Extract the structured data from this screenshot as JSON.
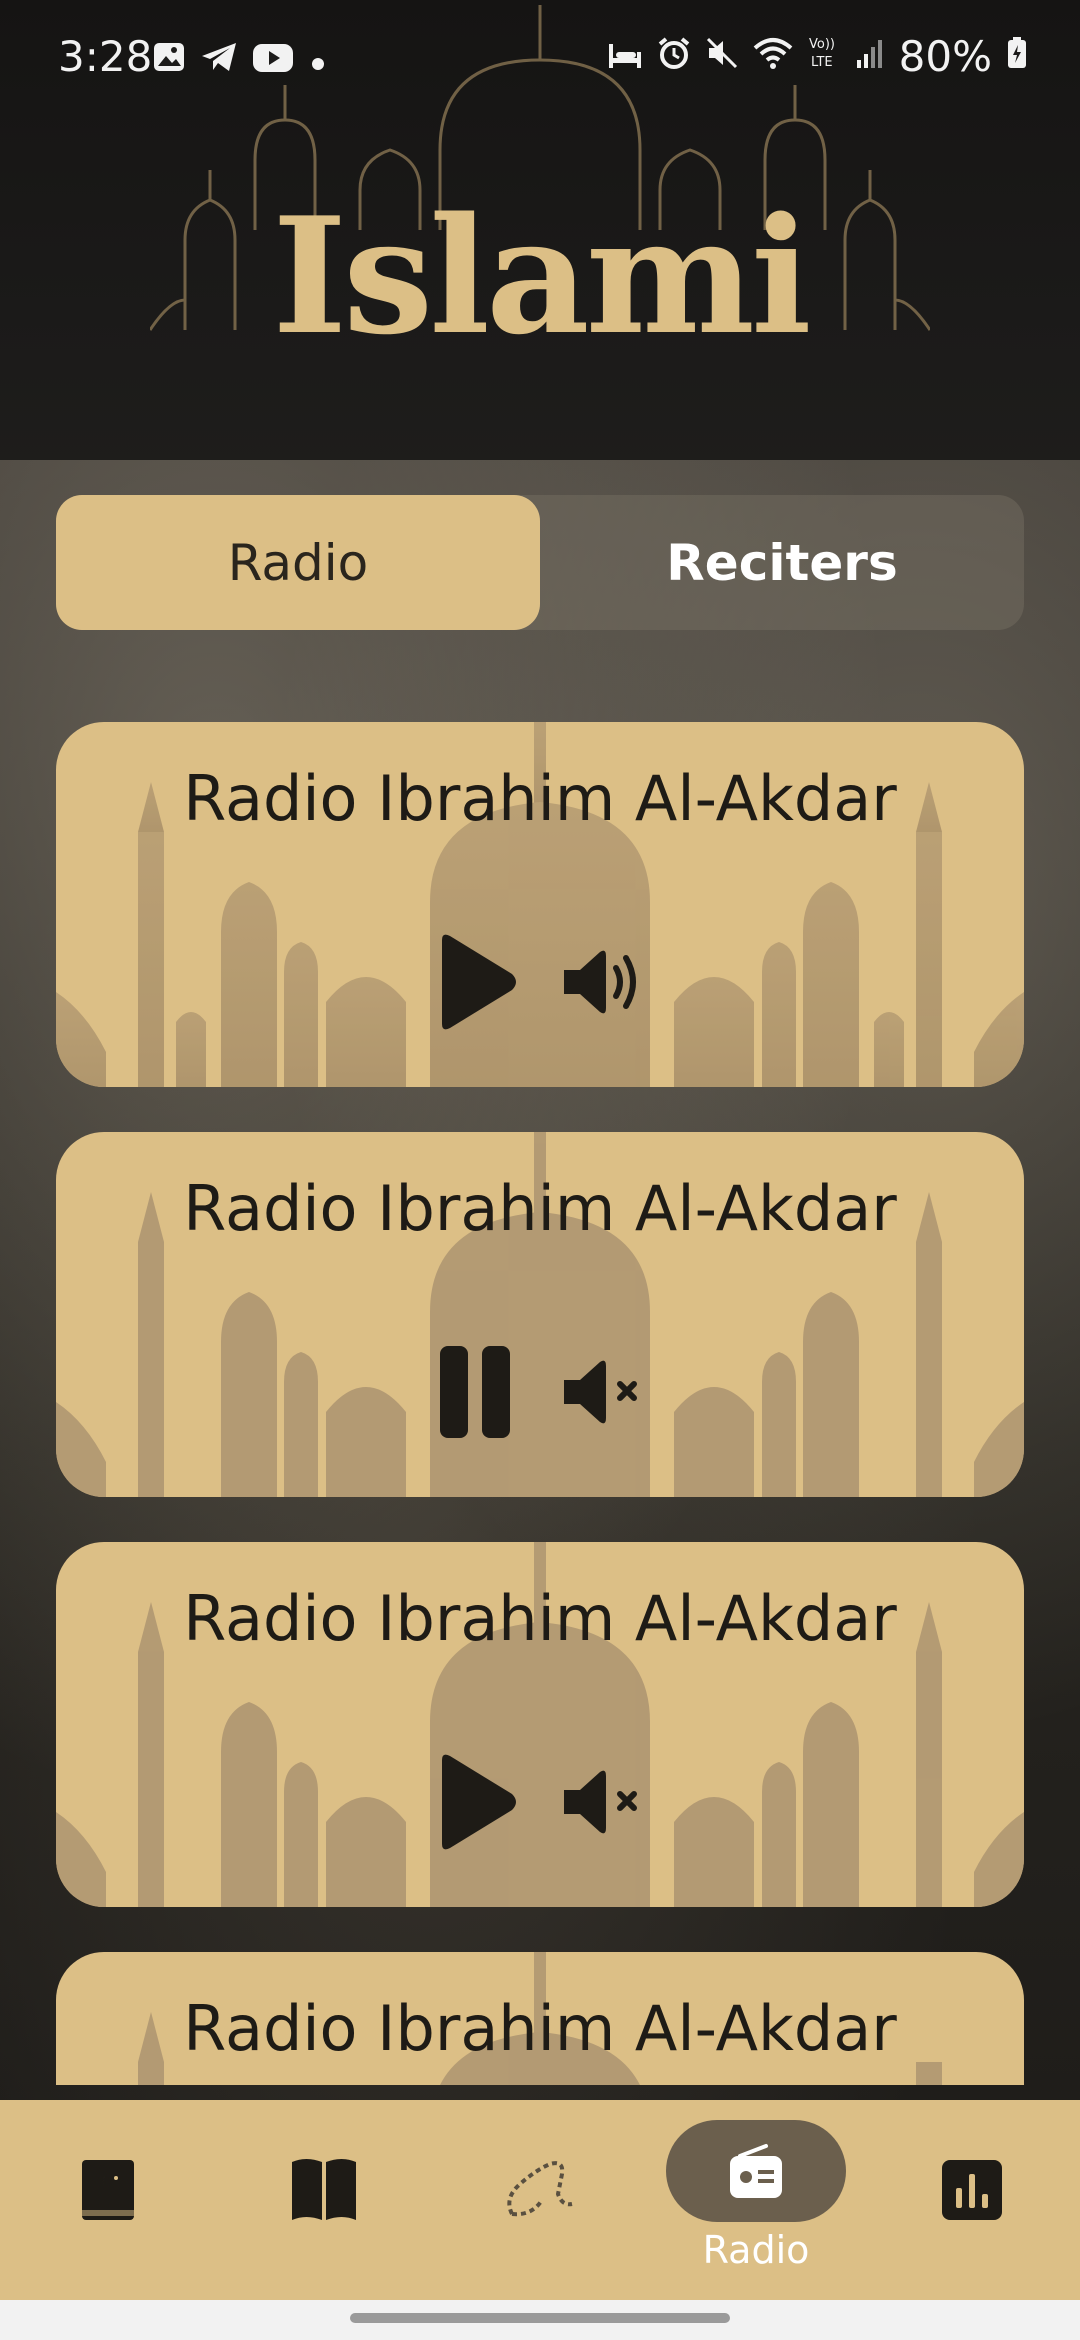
{
  "status_bar": {
    "time": "3:28",
    "battery": "80%",
    "left_icons": [
      "gallery-icon",
      "telegram-icon",
      "youtube-icon",
      "dot-icon"
    ],
    "right_icons": [
      "bed-icon",
      "alarm-icon",
      "mute-icon",
      "wifi-icon",
      "volte-icon",
      "signal-icon",
      "battery-charging-icon"
    ]
  },
  "header": {
    "logo_text": "Islami"
  },
  "tabs": [
    {
      "label": "Radio",
      "selected": true
    },
    {
      "label": "Reciters",
      "selected": false
    }
  ],
  "cards": [
    {
      "title": "Radio Ibrahim Al-Akdar",
      "play_state": "play-icon",
      "volume_state": "volume-on-icon"
    },
    {
      "title": "Radio Ibrahim Al-Akdar",
      "play_state": "pause-icon",
      "volume_state": "volume-muted-icon"
    },
    {
      "title": "Radio Ibrahim Al-Akdar",
      "play_state": "play-icon",
      "volume_state": "volume-muted-icon"
    },
    {
      "title": "Radio Ibrahim Al-Akdar",
      "play_state": "play-icon",
      "volume_state": "volume-muted-icon"
    }
  ],
  "bottom_nav": {
    "items": [
      {
        "icon": "quran-icon",
        "label": ""
      },
      {
        "icon": "hadith-book-icon",
        "label": ""
      },
      {
        "icon": "sebha-icon",
        "label": ""
      },
      {
        "icon": "radio-icon",
        "label": "Radio",
        "active": true
      },
      {
        "icon": "time-chart-icon",
        "label": ""
      }
    ]
  },
  "colors": {
    "gold": "#dcbf86",
    "dark": "#1e1b16",
    "active_pill": "#6b5f4d"
  }
}
